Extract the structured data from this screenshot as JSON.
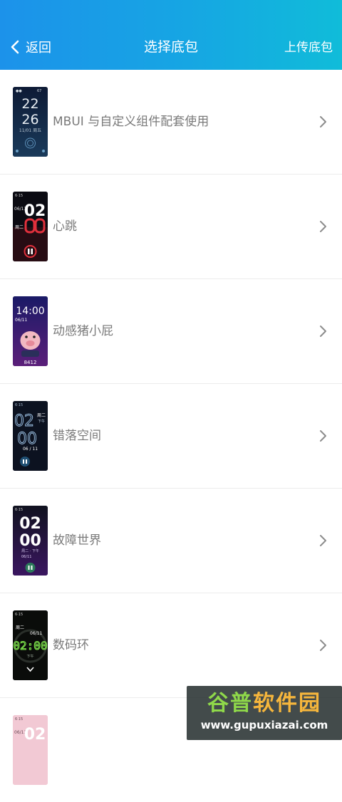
{
  "header": {
    "back_label": "返回",
    "title": "选择底包",
    "upload_label": "上传底包",
    "gradient_start": "#1c92ea",
    "gradient_end": "#10bcd9"
  },
  "packages": [
    {
      "label": "MBUI 与自定义组件配套使用",
      "thumb": {
        "time_top": "22",
        "time_bottom": "26",
        "date": "11/01 周五"
      }
    },
    {
      "label": "心跳",
      "thumb": {
        "time": "02",
        "date": "06/11",
        "day": "周二"
      }
    },
    {
      "label": "动感猪小屁",
      "thumb": {
        "time": "14:00",
        "date": "06/11",
        "steps": "8412"
      }
    },
    {
      "label": "错落空间",
      "thumb": {
        "time_top": "02",
        "time_bottom": "00",
        "day": "周二",
        "ampm": "下午",
        "date": "06 / 11"
      }
    },
    {
      "label": "故障世界",
      "thumb": {
        "time_top": "02",
        "time_bottom": "00",
        "day": "周二 · 下午",
        "date": "06/11"
      }
    },
    {
      "label": "数码环",
      "thumb": {
        "day": "周二",
        "date": "06/11",
        "time": "02:00",
        "ampm": "下午"
      }
    },
    {
      "label": "",
      "thumb": {
        "time": "02",
        "date": "06/11"
      }
    }
  ],
  "watermark": {
    "logo_part1": "谷普",
    "logo_part2": "软件园",
    "url": "www.gupuxiazai.com"
  },
  "icons": {
    "back": "chevron-left-icon",
    "row_arrow": "chevron-right-icon"
  }
}
